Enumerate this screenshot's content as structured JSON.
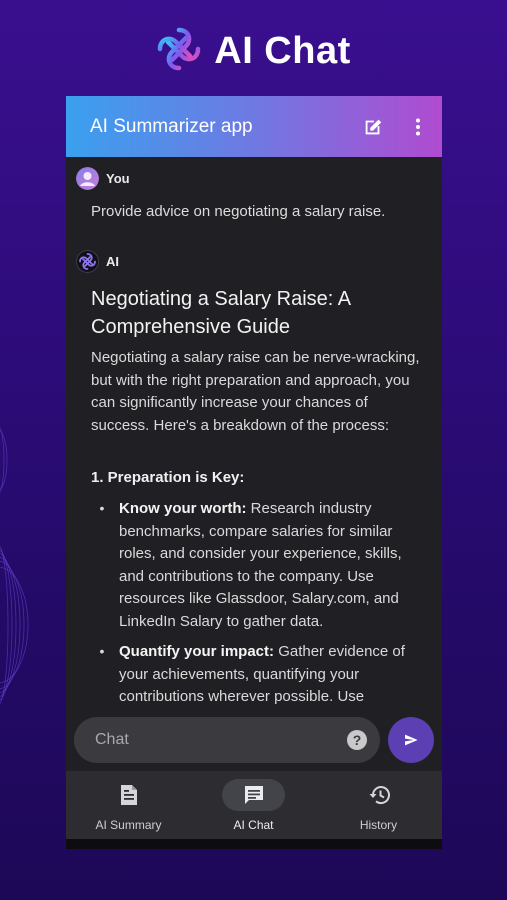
{
  "promo": {
    "title": "AI Chat"
  },
  "app_bar": {
    "title": "AI Summarizer app",
    "icons": [
      "edit-icon",
      "more-vert-icon"
    ]
  },
  "messages": {
    "user": {
      "sender": "You",
      "text": "Provide advice on negotiating a salary raise."
    },
    "ai": {
      "sender": "AI",
      "heading": "Negotiating a Salary Raise: A Comprehensive Guide",
      "intro": "Negotiating a salary raise can be nerve-wracking, but with the right preparation and approach, you can significantly increase your chances of success. Here's a breakdown of the process:",
      "section_title": "1. Preparation is Key:",
      "bullets": [
        {
          "bold": "Know your worth:",
          "text": " Research industry benchmarks, compare salaries for similar roles, and consider your experience, skills, and contributions to the company. Use resources like Glassdoor, Salary.com, and LinkedIn Salary to gather data."
        },
        {
          "bold": "Quantify your impact:",
          "text": " Gather evidence of your achievements, quantifying your contributions wherever possible. Use"
        }
      ]
    }
  },
  "input": {
    "placeholder": "Chat",
    "value": "",
    "help_icon": "help-icon",
    "send_icon": "send-icon"
  },
  "bottom_nav": [
    {
      "label": "AI Summary",
      "icon": "document-icon",
      "active": false
    },
    {
      "label": "AI Chat",
      "icon": "chat-icon",
      "active": true
    },
    {
      "label": "History",
      "icon": "history-icon",
      "active": false
    }
  ],
  "colors": {
    "accent": "#5b3fb3",
    "app_bar_start": "#3aa0ef",
    "app_bar_end": "#b04bd0",
    "background": "#2e0c7c"
  }
}
